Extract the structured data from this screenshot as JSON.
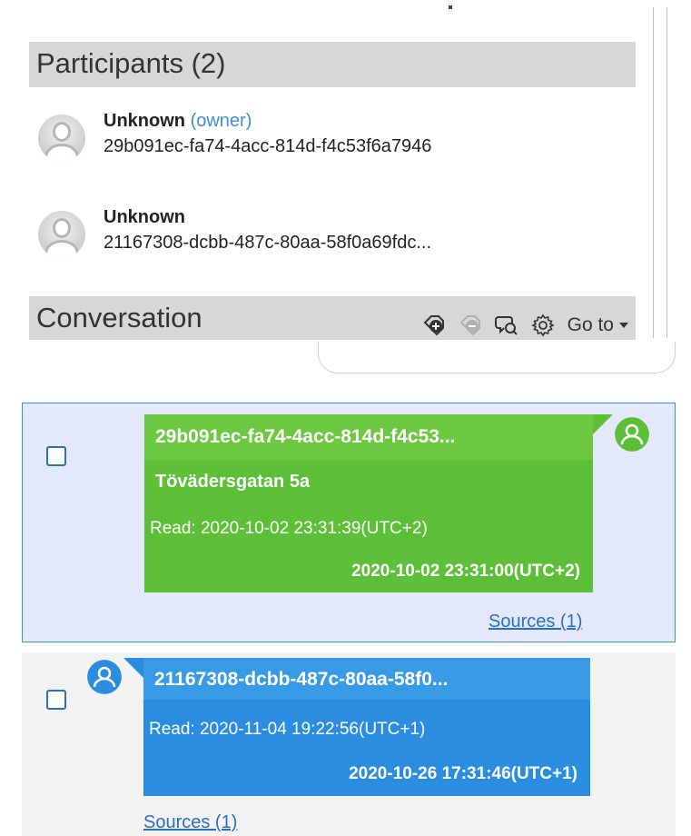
{
  "participants": {
    "header": "Participants (2)",
    "items": [
      {
        "name": "Unknown",
        "role": "(owner)",
        "id": "29b091ec-fa74-4acc-814d-f4c53f6a7946"
      },
      {
        "name": "Unknown",
        "role": "",
        "id": "21167308-dcbb-487c-80aa-58f0a69fdc..."
      }
    ]
  },
  "conversation": {
    "header": "Conversation",
    "toolbar": {
      "icons": [
        "tag-add-icon",
        "tag-remove-icon",
        "chat-search-icon",
        "settings-gear-icon"
      ],
      "goto_label": "Go to"
    }
  },
  "messages": [
    {
      "sender": "29b091ec-fa74-4acc-814d-f4c53...",
      "body": "Tövädersgatan 5a",
      "read": "Read: 2020-10-02 23:31:39(UTC+2)",
      "timestamp": "2020-10-02 23:31:00(UTC+2)",
      "sources": "Sources (1)",
      "direction": "outgoing",
      "color": "#5cbf37",
      "selected": true
    },
    {
      "sender": "21167308-dcbb-487c-80aa-58f0...",
      "read": "Read: 2020-11-04 19:22:56(UTC+1)",
      "timestamp": "2020-10-26 17:31:46(UTC+1)",
      "sources": "Sources (1)",
      "direction": "incoming",
      "color": "#2a8de0",
      "selected": false
    }
  ],
  "colors": {
    "header_bg": "#d7d7d7",
    "selected_row_bg": "#e3e9fb",
    "selected_row_border": "#3a8fd8",
    "link": "#2a6fc0",
    "owner_text": "#3a8fd8"
  }
}
